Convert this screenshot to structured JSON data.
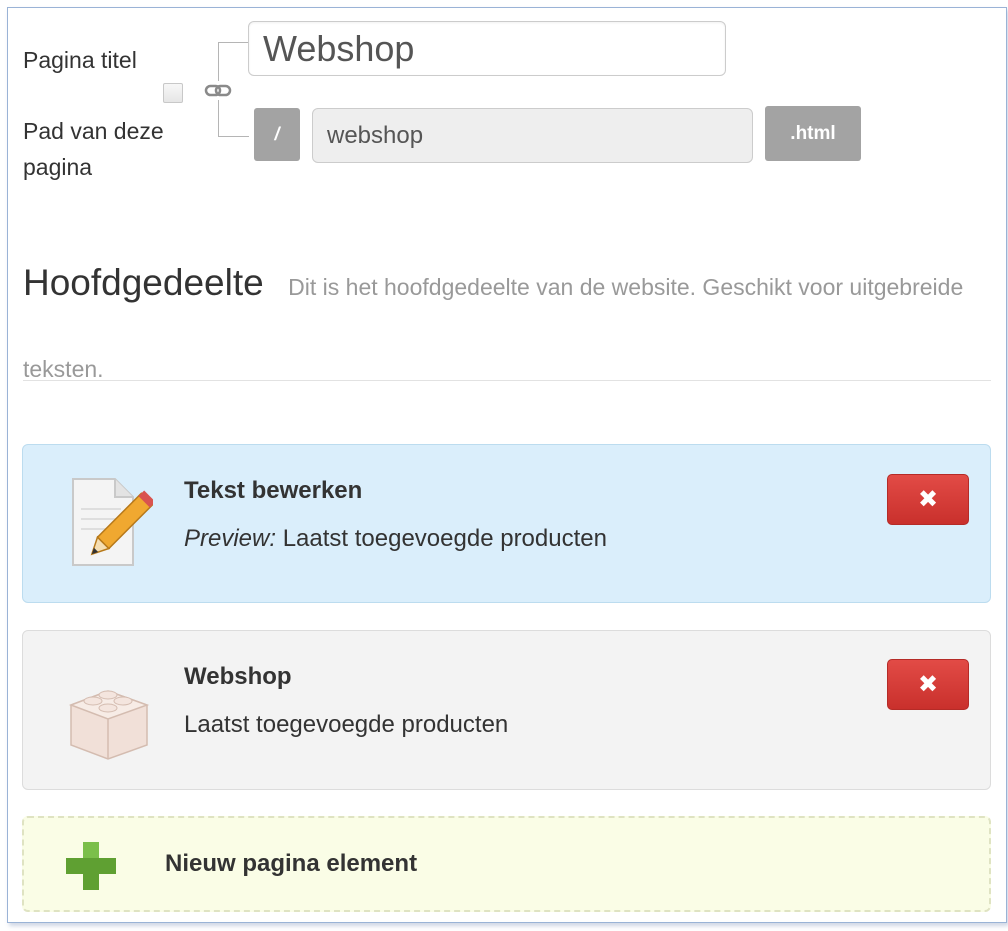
{
  "form": {
    "page_title_label": "Pagina titel",
    "path_label": "Pad van deze pagina",
    "title_value": "Webshop",
    "path_prefix": "/",
    "path_value": "webshop",
    "path_suffix": ".html"
  },
  "section": {
    "title": "Hoofdgedeelte",
    "description": "Dit is het hoofdgedeelte van de website. Geschikt voor uitgebreide teksten."
  },
  "elements": [
    {
      "title": "Tekst bewerken",
      "preview_label": "Preview:",
      "preview_text": "Laatst toegevoegde producten",
      "icon": "edit-document-icon",
      "delete_label": "✖"
    },
    {
      "title": "Webshop",
      "subtitle": "Laatst toegevoegde producten",
      "icon": "lego-brick-icon",
      "delete_label": "✖"
    }
  ],
  "add_element": {
    "label": "Nieuw pagina element",
    "icon": "plus-icon"
  },
  "colors": {
    "accent_blue": "#daeefb",
    "danger": "#d9534f",
    "addon_gray": "#a3a3a3",
    "add_green": "#5fa032"
  }
}
